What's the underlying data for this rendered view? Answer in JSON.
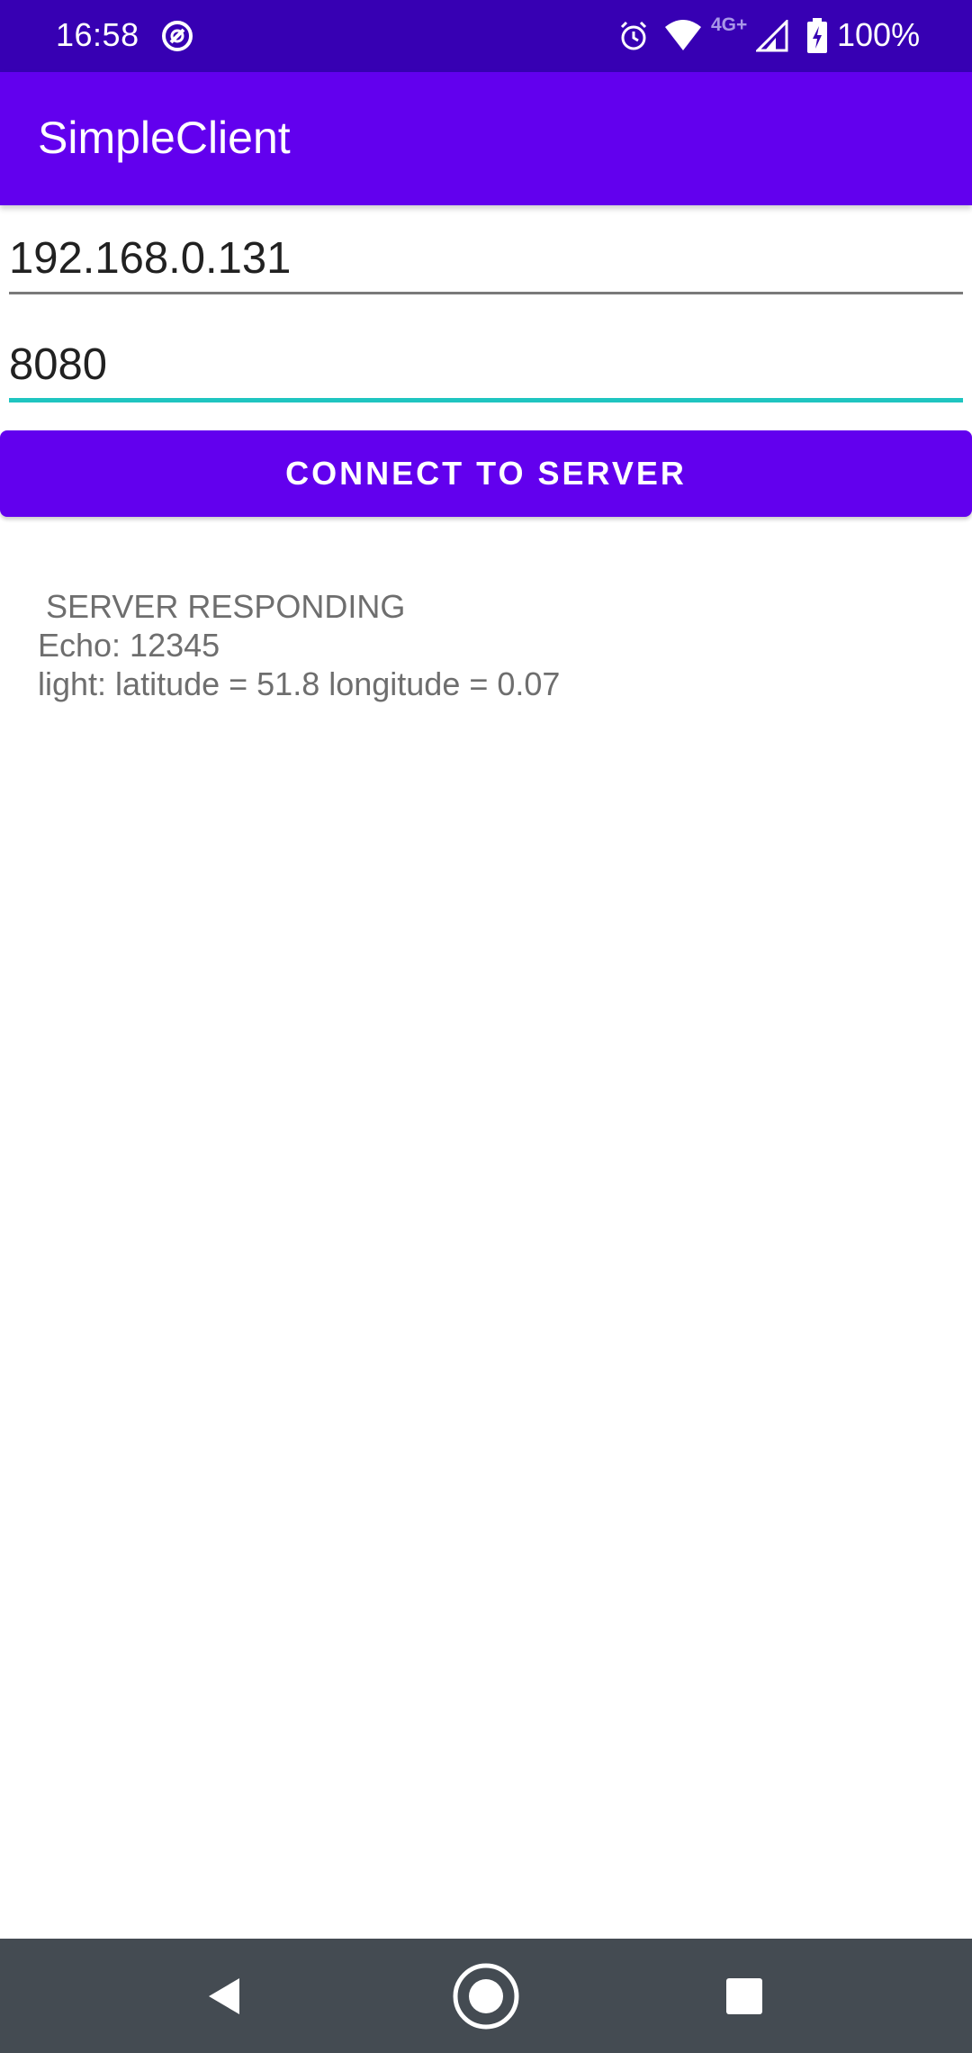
{
  "status_bar": {
    "time": "16:58",
    "network_type": "4G+",
    "battery": "100%",
    "icons": [
      "at-sign-icon",
      "alarm-icon",
      "wifi-icon",
      "signal-icon",
      "battery-charging-icon"
    ]
  },
  "app_bar": {
    "title": "SimpleClient"
  },
  "form": {
    "ip_value": "192.168.0.131",
    "port_value": "8080",
    "connect_label": "CONNECT TO SERVER"
  },
  "response": {
    "line1": "SERVER RESPONDING",
    "line2": "Echo: 12345",
    "line3": "light: latitude = 51.8 longitude = 0.07"
  },
  "nav_bar": {
    "icons": [
      "back-icon",
      "home-icon",
      "recents-icon"
    ]
  },
  "colors": {
    "status_bar": "#3700b3",
    "primary": "#6200ee",
    "accent": "#1fc5c0",
    "nav_bar": "#444b52"
  }
}
